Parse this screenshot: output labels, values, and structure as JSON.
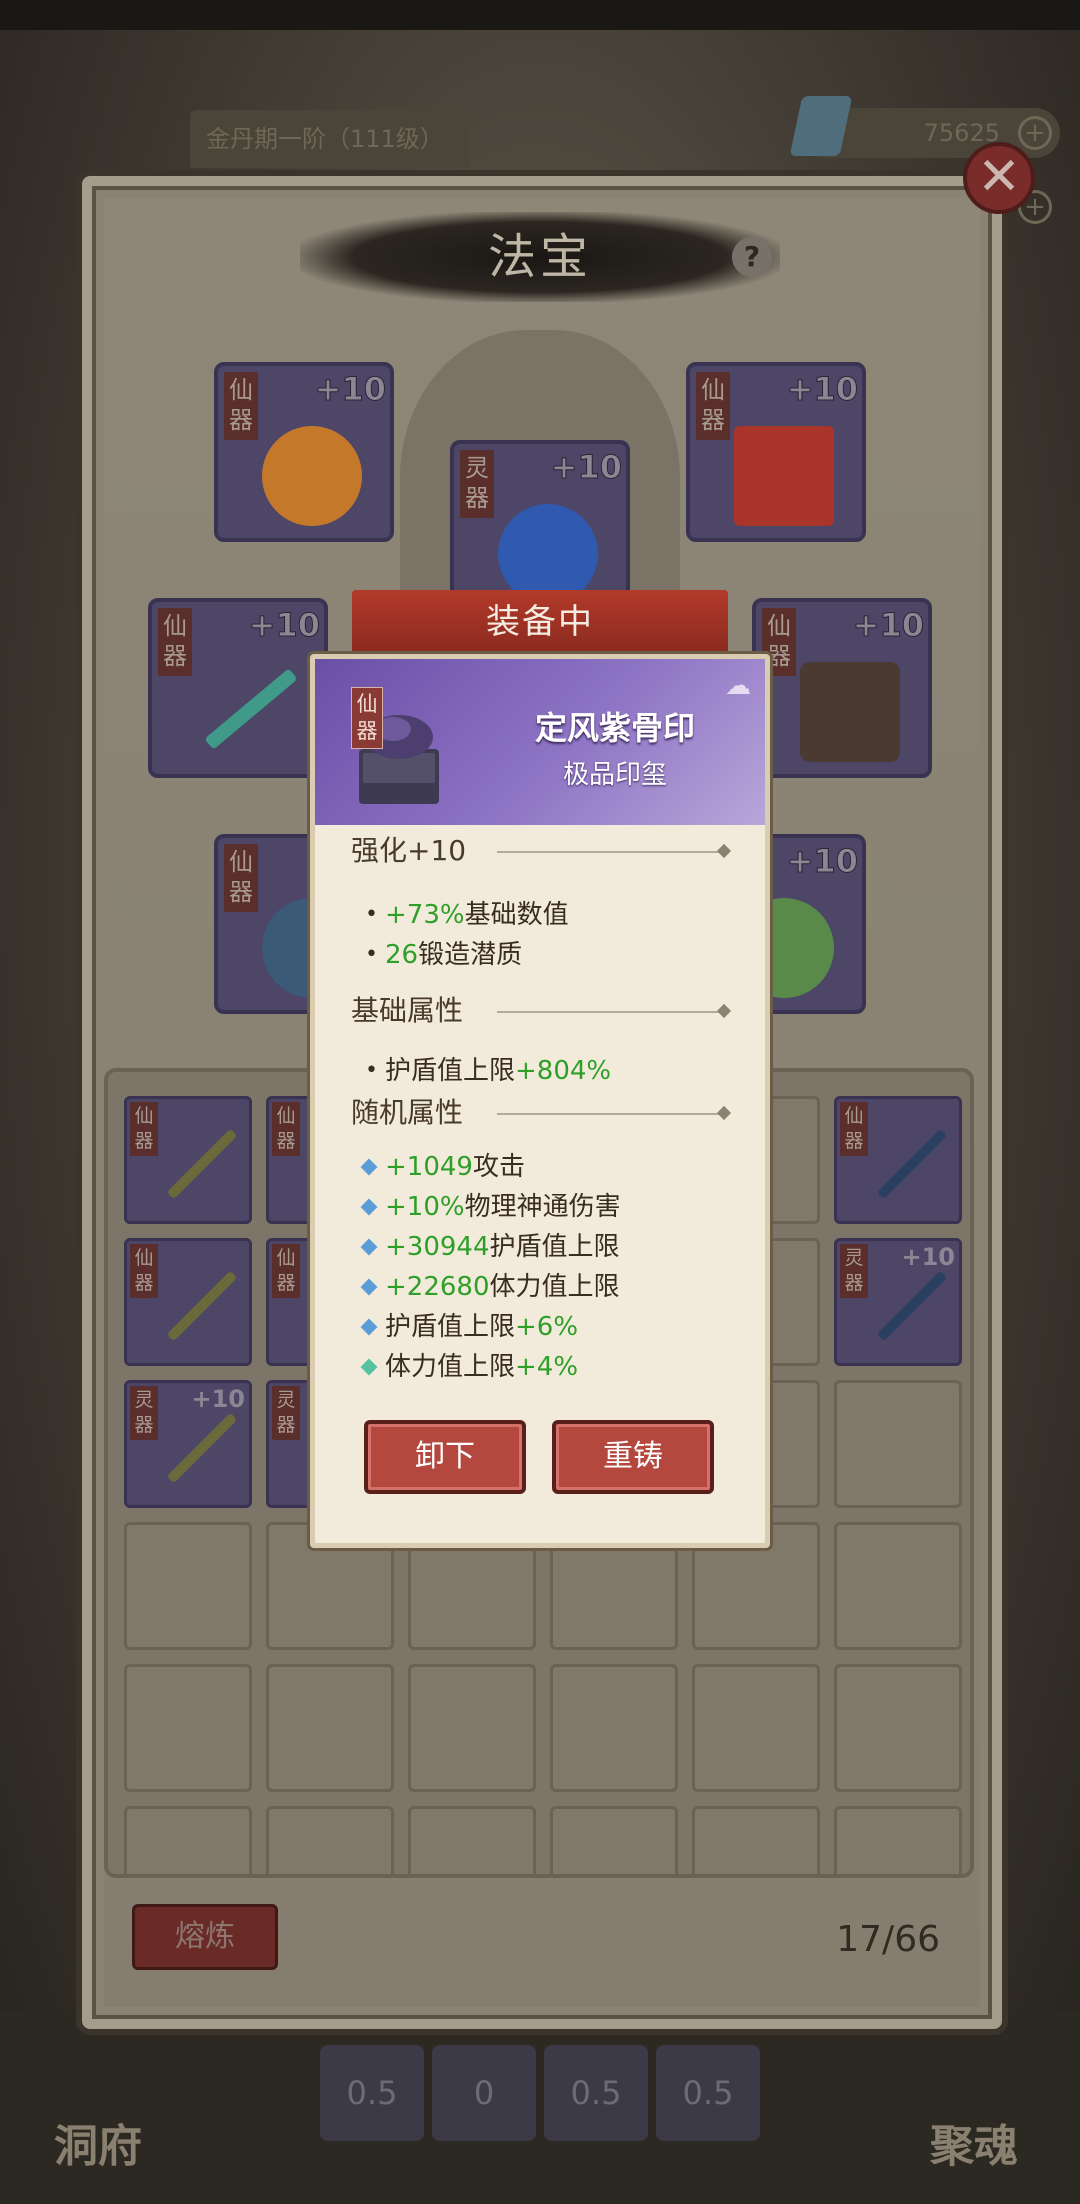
{
  "background": {
    "rank_text": "金丹期一阶（111级）",
    "currency_value": "75625",
    "left_nav_label": "洞府",
    "right_nav_label": "聚魂",
    "skill_values": [
      "0.5",
      "0",
      "0.5",
      "0.5"
    ]
  },
  "panel": {
    "title": "法宝",
    "help": "?",
    "close": "✕",
    "equipped_label": "装备中",
    "slots": [
      {
        "tier": "仙器",
        "level": "+10"
      },
      {
        "tier": "灵器",
        "level": "+10"
      },
      {
        "tier": "仙器",
        "level": "+10"
      },
      {
        "tier": "仙器",
        "level": "+10"
      },
      {
        "tier": "仙器",
        "level": "+10"
      },
      {
        "tier": "仙器",
        "level": ""
      },
      {
        "tier": "",
        "level": "+10"
      }
    ],
    "inventory": {
      "rows": [
        [
          {
            "tier": "仙器",
            "level": ""
          },
          {
            "tier": "仙器",
            "level": ""
          },
          {
            "tier": "",
            "level": ""
          },
          {
            "tier": "",
            "level": ""
          },
          {
            "tier": "",
            "level": ""
          },
          {
            "tier": "仙器",
            "level": ""
          }
        ],
        [
          {
            "tier": "仙器",
            "level": ""
          },
          {
            "tier": "仙器",
            "level": ""
          },
          {
            "tier": "",
            "level": ""
          },
          {
            "tier": "",
            "level": ""
          },
          {
            "tier": "",
            "level": ""
          },
          {
            "tier": "灵器",
            "level": "+10"
          }
        ],
        [
          {
            "tier": "灵器",
            "level": "+10"
          },
          {
            "tier": "灵器",
            "level": ""
          },
          {
            "tier": "",
            "level": ""
          },
          {
            "tier": "",
            "level": ""
          },
          {
            "tier": "",
            "level": ""
          },
          {
            "tier": "",
            "level": ""
          }
        ]
      ]
    },
    "smelt_button": "熔炼",
    "bag_count": "17/66"
  },
  "item_popup": {
    "tier": "仙器",
    "name": "定风紫骨印",
    "type": "极品印玺",
    "enhance_header": "强化+10",
    "enhance_stats": [
      {
        "value": "+73%",
        "label": "基础数值"
      },
      {
        "value": "26",
        "label": "锻造潜质"
      }
    ],
    "base_header": "基础属性",
    "base_stats": [
      {
        "label": "护盾值上限",
        "value": "+804%"
      }
    ],
    "random_header": "随机属性",
    "random_stats": [
      {
        "pre": "+1049",
        "label": "攻击",
        "post": "",
        "gem": "blue"
      },
      {
        "pre": "+10%",
        "label": "物理神通伤害",
        "post": "",
        "gem": "blue"
      },
      {
        "pre": "+30944",
        "label": "护盾值上限",
        "post": "",
        "gem": "blue"
      },
      {
        "pre": "+22680",
        "label": "体力值上限",
        "post": "",
        "gem": "blue"
      },
      {
        "pre": "",
        "label": "护盾值上限",
        "post": "+6%",
        "gem": "blue"
      },
      {
        "pre": "",
        "label": "体力值上限",
        "post": "+4%",
        "gem": "green"
      }
    ],
    "unequip_button": "卸下",
    "reforge_button": "重铸"
  }
}
